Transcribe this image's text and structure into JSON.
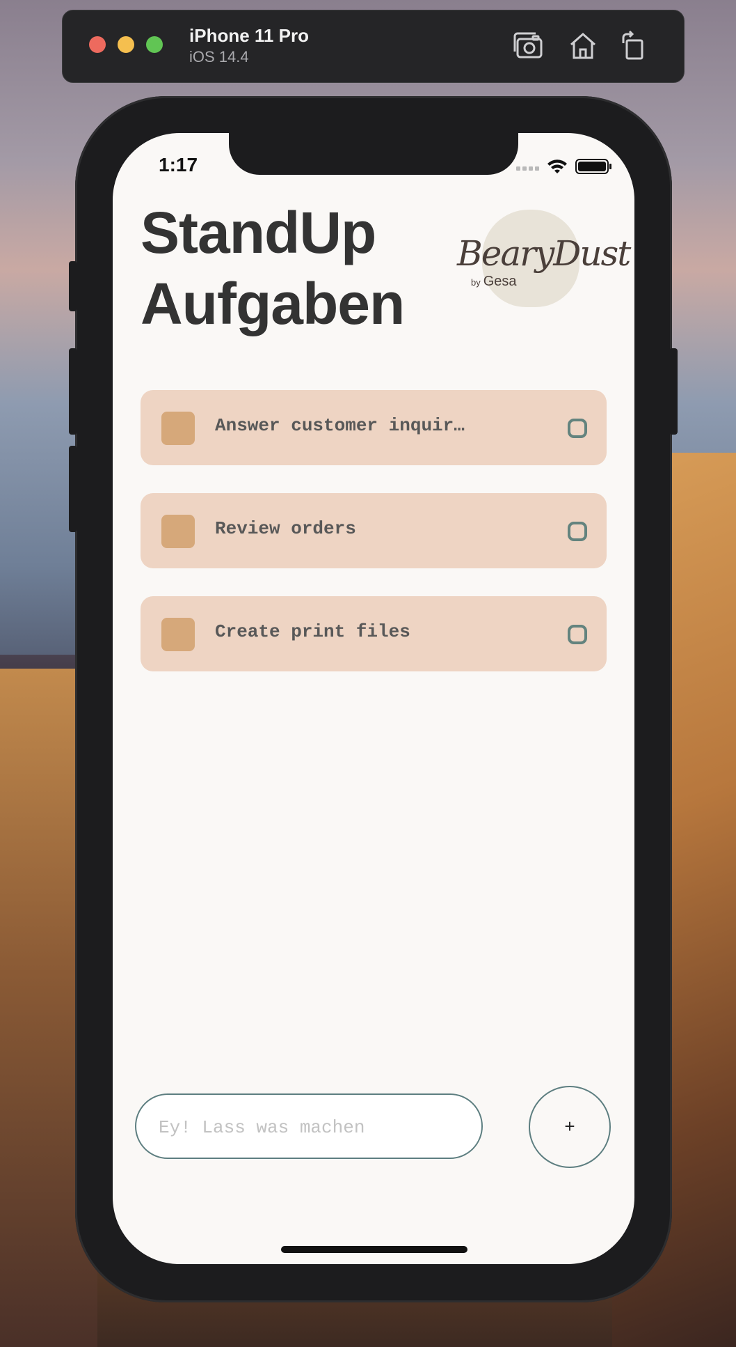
{
  "simulator": {
    "device_name": "iPhone 11 Pro",
    "os_version": "iOS 14.4",
    "icons": [
      "screenshot-icon",
      "home-icon",
      "rotate-icon"
    ]
  },
  "status_bar": {
    "time": "1:17",
    "icons": [
      "signal-icon",
      "wifi-icon",
      "battery-icon"
    ]
  },
  "header": {
    "title_line1": "StandUp",
    "title_line2": "Aufgaben",
    "logo_text": "BearyDust",
    "logo_by": "by",
    "logo_author": "Gesa"
  },
  "tasks": [
    {
      "label": "Answer customer inquir…",
      "checked": false
    },
    {
      "label": "Review orders",
      "checked": false
    },
    {
      "label": "Create print files",
      "checked": false
    }
  ],
  "composer": {
    "placeholder": "Ey! Lass was machen",
    "value": "",
    "add_label": "+"
  },
  "colors": {
    "task_bg": "#eed4c3",
    "checkbox": "#d6a87a",
    "accent": "#5d7e80",
    "title": "#333333"
  }
}
